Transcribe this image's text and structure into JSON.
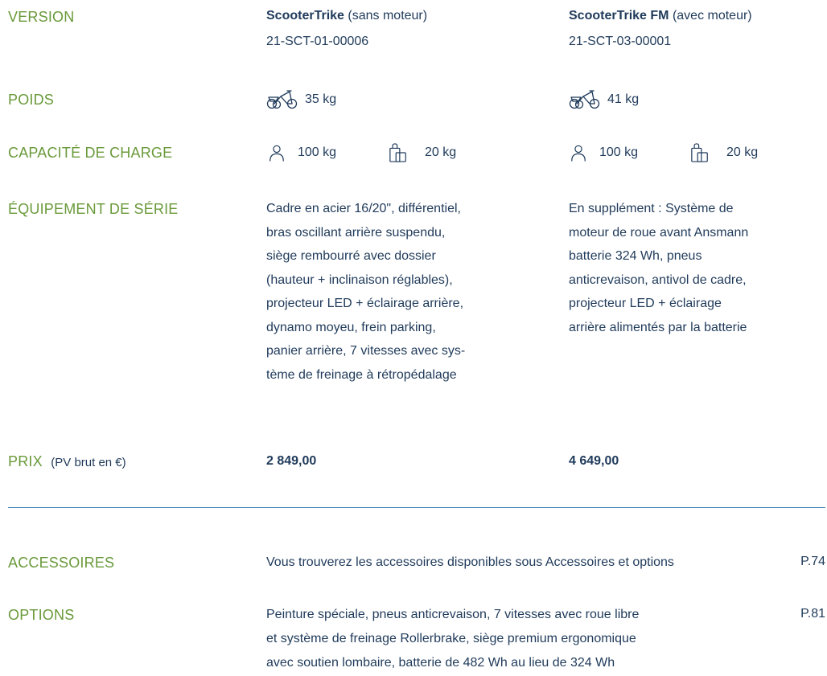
{
  "labels": {
    "version": "VERSION",
    "poids": "POIDS",
    "capacite": "CAPACITÉ DE CHARGE",
    "equipement": "ÉQUIPEMENT DE SÉRIE",
    "prix": "PRIX",
    "prix_note": "(PV brut en €)",
    "accessoires": "ACCESSOIRES",
    "options": "OPTIONS"
  },
  "models": [
    {
      "name": "ScooterTrike",
      "name_suffix": "(sans moteur)",
      "code": "21-SCT-01-00006",
      "weight": "35 kg",
      "rider_capacity": "100 kg",
      "luggage_capacity": "20 kg",
      "equipment_lines": [
        "Cadre en acier 16/20\", différentiel,",
        "bras oscillant arrière suspendu,",
        "siège rembourré avec dossier",
        "(hauteur + inclinaison réglables),",
        "projecteur LED + éclairage arrière,",
        "dynamo moyeu, frein parking,",
        "panier arrière, 7 vitesses avec sys-",
        "tème de freinage à rétropédalage"
      ],
      "price": "2 849,00"
    },
    {
      "name": "ScooterTrike FM",
      "name_suffix": "(avec moteur)",
      "code": "21-SCT-03-00001",
      "weight": "41 kg",
      "rider_capacity": "100 kg",
      "luggage_capacity": "20 kg",
      "equipment_lines": [
        "En supplément : Système de",
        "moteur de roue avant Ansmann",
        "batterie 324 Wh, pneus",
        "anticrevaison, antivol de cadre,",
        "projecteur LED + éclairage",
        "arrière alimentés par la batterie"
      ],
      "price": "4 649,00"
    }
  ],
  "accessoires": {
    "text": "Vous trouverez les accessoires disponibles sous Accessoires et options",
    "page": "P.74"
  },
  "options": {
    "lines": [
      "Peinture spéciale, pneus anticrevaison, 7 vitesses avec roue libre",
      "et système de freinage Rollerbrake, siège premium ergonomique",
      "avec soutien lombaire, batterie de 482 Wh au lieu de 324 Wh"
    ],
    "page": "P.81"
  },
  "icons": {
    "weight": "trike-icon",
    "rider": "person-icon",
    "luggage": "bag-icon"
  },
  "colors": {
    "label_green": "#6a9a3a",
    "text_navy": "#1f3a5a",
    "divider_blue": "#3b7fb5"
  }
}
